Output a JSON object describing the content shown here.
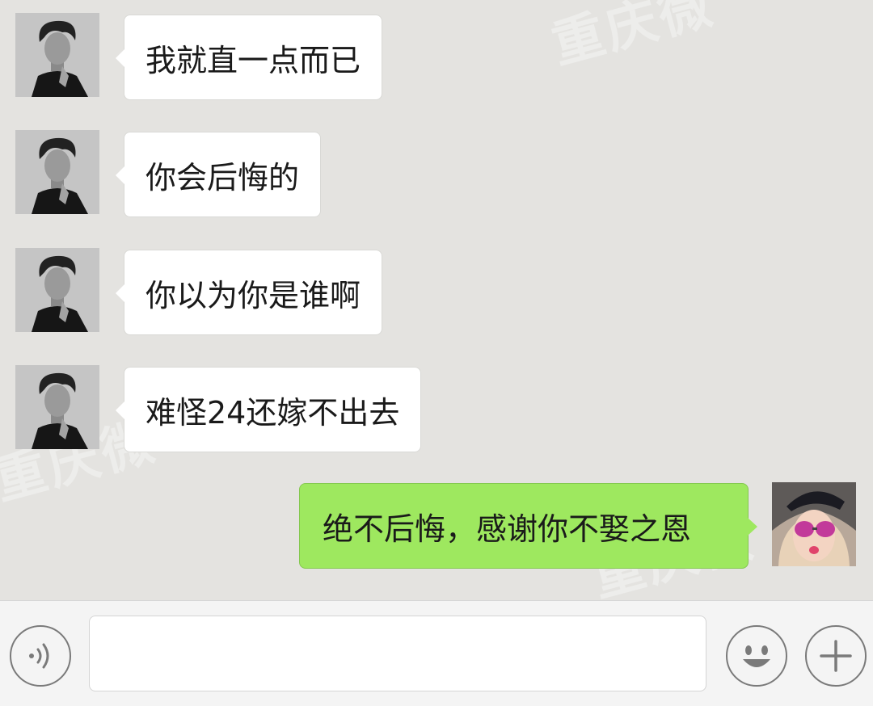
{
  "watermark": "重庆微",
  "messages": [
    {
      "side": "in",
      "text": "我就直一点而已"
    },
    {
      "side": "in",
      "text": "你会后悔的"
    },
    {
      "side": "in",
      "text": "你以为你是谁啊"
    },
    {
      "side": "in",
      "text": "难怪24还嫁不出去"
    },
    {
      "side": "out",
      "text": "绝不后悔，感谢你不娶之恩"
    }
  ],
  "input": {
    "value": ""
  },
  "colors": {
    "background": "#e4e3e0",
    "incoming_bubble": "#ffffff",
    "outgoing_bubble": "#9ee85f",
    "icon": "#7a7a7a"
  },
  "icons": {
    "voice": "voice-icon",
    "emoji": "emoji-icon",
    "more": "plus-icon"
  }
}
